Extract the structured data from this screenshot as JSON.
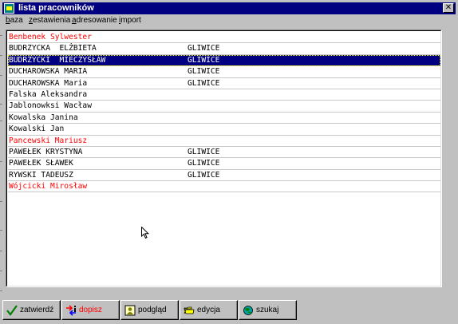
{
  "window": {
    "title": "lista pracowników",
    "close_glyph": "✕"
  },
  "menu": [
    "baza",
    "zestawienia",
    "adresowanie",
    "import"
  ],
  "employees": [
    {
      "name": "Benbenek Sylwester",
      "city": "",
      "color": "red"
    },
    {
      "name": "BUDRZYCKA  ELŻBIETA",
      "city": "GLIWICE",
      "color": "black"
    },
    {
      "name": "BUDRZYCKI  MIECZYSŁAW",
      "city": "GLIWICE",
      "color": "black",
      "selected": true
    },
    {
      "name": "DUCHAROWSKA MARIA",
      "city": "GLIWICE",
      "color": "black"
    },
    {
      "name": "DUCHAROWSKA Maria",
      "city": "GLIWICE",
      "color": "black"
    },
    {
      "name": "Falska Aleksandra",
      "city": "",
      "color": "black"
    },
    {
      "name": "Jablonowksi Wacław",
      "city": "",
      "color": "black"
    },
    {
      "name": "Kowalska Janina",
      "city": "",
      "color": "black"
    },
    {
      "name": "Kowalski Jan",
      "city": "",
      "color": "black"
    },
    {
      "name": "Pancewski Mariusz",
      "city": "",
      "color": "red"
    },
    {
      "name": "PAWEŁEK KRYSTYNA",
      "city": "GLIWICE",
      "color": "black"
    },
    {
      "name": "PAWEŁEK SŁAWEK",
      "city": "GLIWICE",
      "color": "black"
    },
    {
      "name": "RYWSKI TADEUSZ",
      "city": "GLIWICE",
      "color": "black"
    },
    {
      "name": "Wójcicki Mirosław",
      "city": "",
      "color": "red"
    }
  ],
  "toolbar": {
    "confirm": "zatwierdź",
    "add": "dopisz",
    "preview": "podgląd",
    "edit": "edycja",
    "search": "szukaj"
  },
  "colors": {
    "titlebar": "#000080",
    "selection": "#000080",
    "highlight_text": "#ff0000",
    "face": "#c0c0c0"
  }
}
